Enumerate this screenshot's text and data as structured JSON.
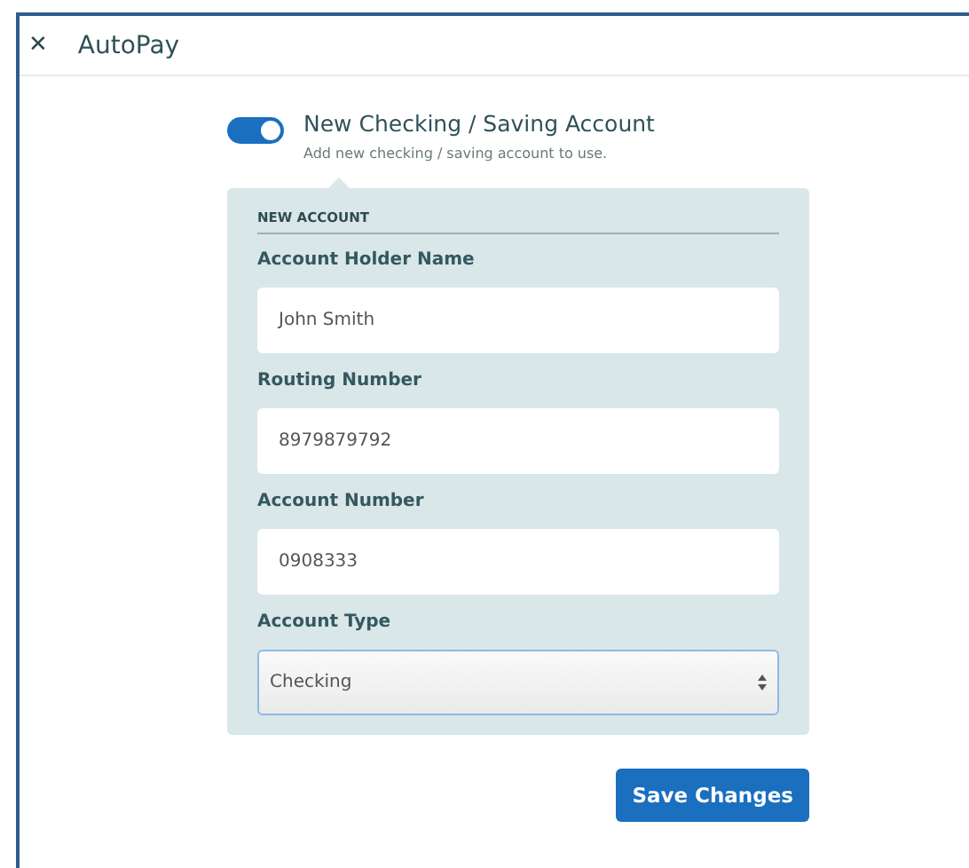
{
  "window": {
    "title": "AutoPay",
    "close_icon": "✕"
  },
  "toggle": {
    "on": true,
    "label": "New Checking / Saving Account",
    "description": "Add new checking / saving account to use."
  },
  "section": {
    "title": "NEW ACCOUNT",
    "fields": [
      {
        "kind": "input",
        "label": "Account Holder Name",
        "value": "John Smith"
      },
      {
        "kind": "input",
        "label": "Routing Number",
        "value": "8979879792"
      },
      {
        "kind": "input",
        "label": "Account Number",
        "value": "0908333"
      },
      {
        "kind": "select",
        "label": "Account Type",
        "value": "Checking"
      }
    ]
  },
  "buttons": [
    "Save Changes"
  ]
}
